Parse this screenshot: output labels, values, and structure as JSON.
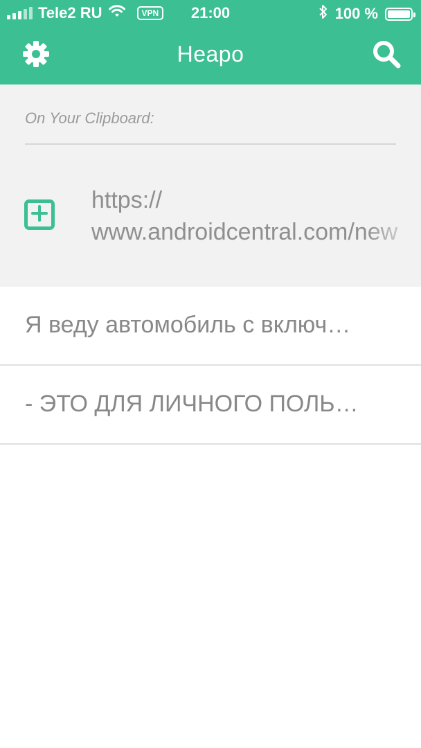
{
  "status": {
    "carrier": "Tele2 RU",
    "vpn": "VPN",
    "time": "21:00",
    "battery_text": "100 %",
    "battery_level": 1.0
  },
  "nav": {
    "title": "Неаро",
    "left_icon": "gear-icon",
    "right_icon": "search-icon"
  },
  "clipboard": {
    "label": "On Your Clipboard:",
    "line1": "https://",
    "line2": "www.androidcentral.com/new"
  },
  "items": [
    {
      "text": "Я веду автомобиль с включ…"
    },
    {
      "text": "- ЭТО ДЛЯ ЛИЧНОГО ПОЛЬ…"
    }
  ],
  "colors": {
    "accent": "#3cbf92",
    "clipboard_bg": "#f2f2f2",
    "text_muted": "#888888"
  }
}
